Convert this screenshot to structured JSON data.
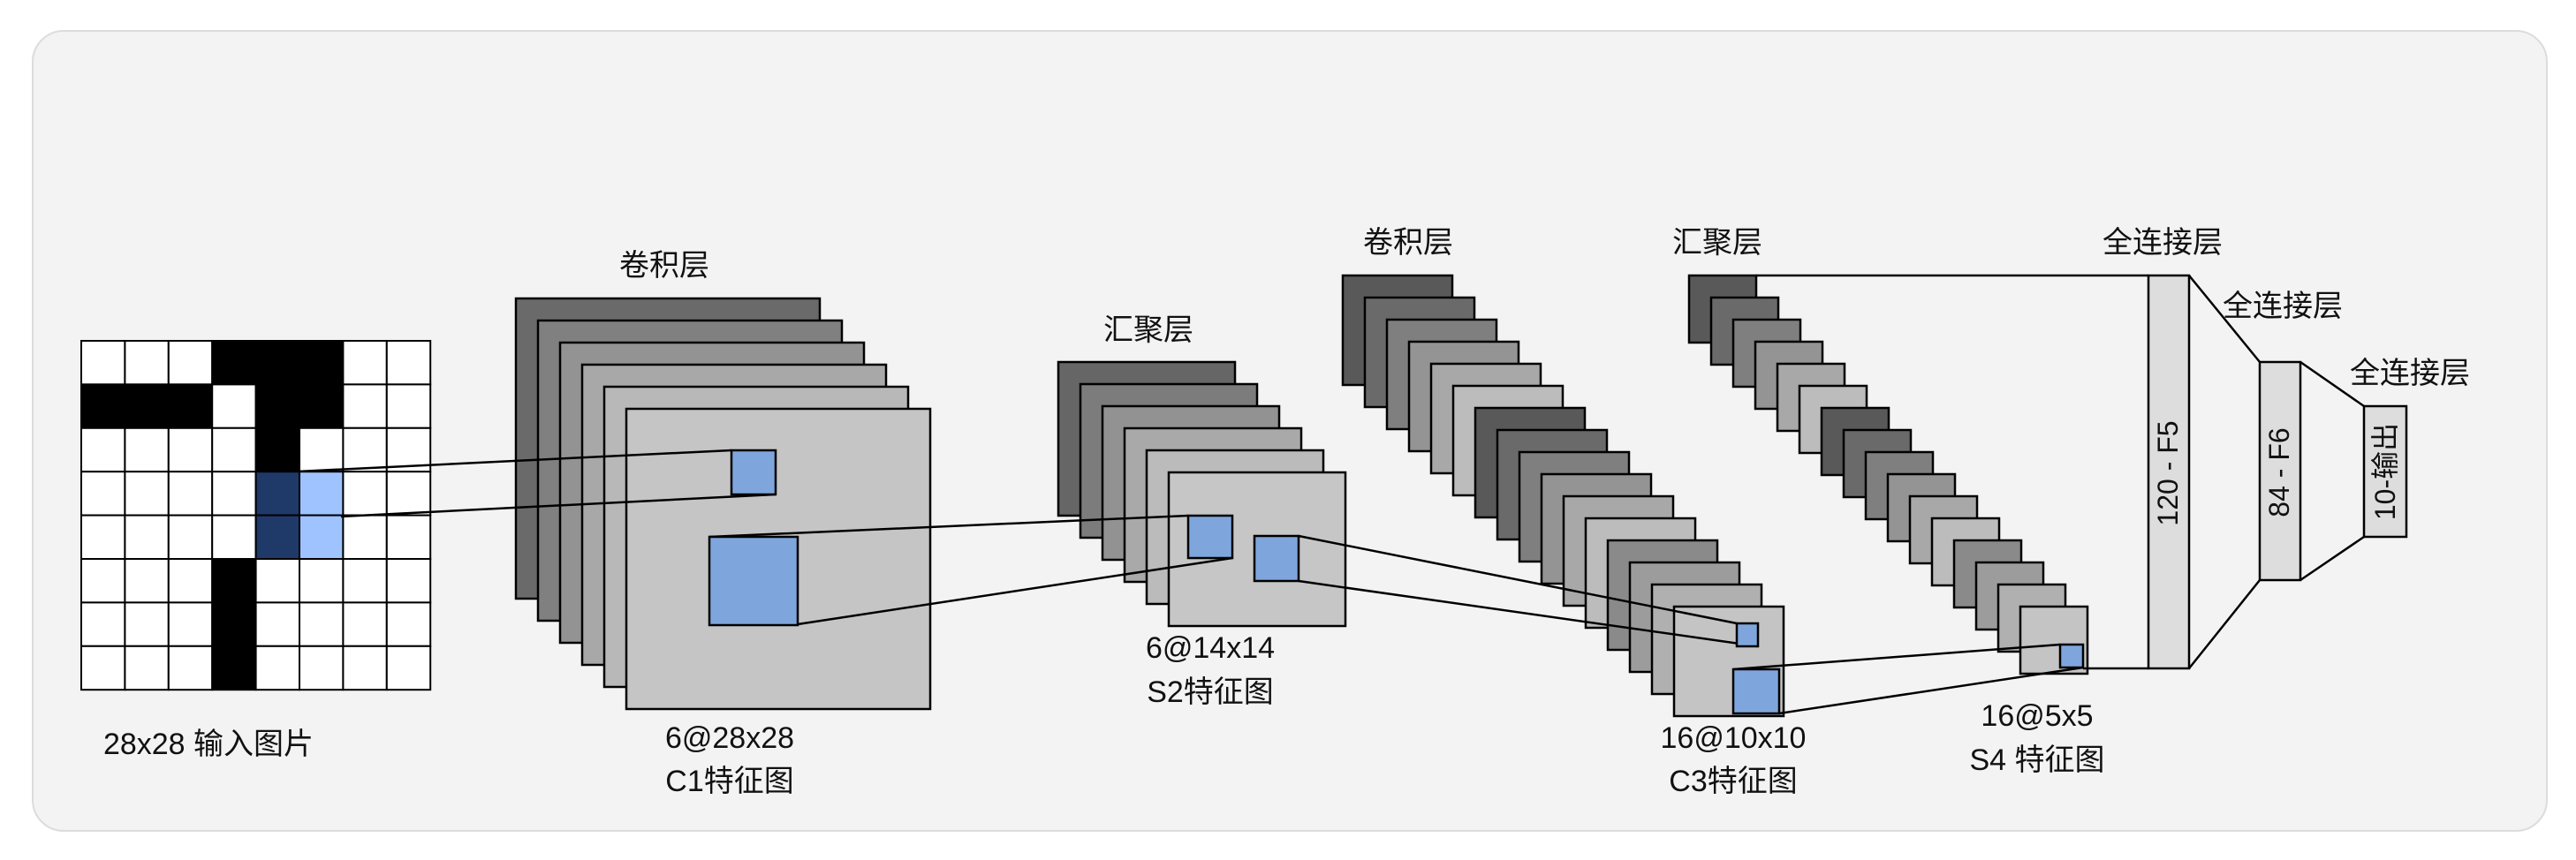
{
  "input": {
    "caption": "28x28 输入图片",
    "grid_cols": 8,
    "grid_rows": 8,
    "black_cells": [
      [
        0,
        3
      ],
      [
        0,
        4
      ],
      [
        0,
        5
      ],
      [
        1,
        0
      ],
      [
        1,
        1
      ],
      [
        1,
        2
      ],
      [
        1,
        4
      ],
      [
        1,
        5
      ],
      [
        2,
        4
      ],
      [
        3,
        4
      ],
      [
        4,
        4
      ],
      [
        5,
        3
      ],
      [
        6,
        3
      ],
      [
        7,
        3
      ]
    ],
    "kernel_dark_cells": [
      [
        3,
        4
      ],
      [
        4,
        4
      ]
    ],
    "kernel_light_cells": [
      [
        3,
        5
      ],
      [
        4,
        5
      ]
    ]
  },
  "layers": {
    "c1": {
      "title": "卷积层",
      "shape": "6@28x28",
      "name": "C1特征图"
    },
    "s2": {
      "title": "汇聚层",
      "shape": "6@14x14",
      "name": "S2特征图"
    },
    "c3": {
      "title": "卷积层",
      "shape": "16@10x10",
      "name": "C3特征图"
    },
    "s4": {
      "title": "汇聚层",
      "shape": "16@5x5",
      "name": "S4 特征图"
    },
    "f5": {
      "title": "全连接层",
      "label": "120 - F5"
    },
    "f6": {
      "title": "全连接层",
      "label": "84 - F6"
    },
    "out": {
      "title": "全连接层",
      "label": "10-输出"
    }
  },
  "colors": {
    "card_bg": "#f3f3f3",
    "kernel_blue": "#7fa6dc",
    "kernel_dark": "#1f3a68",
    "kernel_light": "#9fc3ff",
    "stack_c1": [
      "#6a6a6a",
      "#808080",
      "#939393",
      "#a8a8a8",
      "#b8b8b8",
      "#c5c5c5"
    ],
    "stack_s2": [
      "#666666",
      "#7c7c7c",
      "#929292",
      "#a9a9a9",
      "#bbbbbb",
      "#c6c6c6"
    ],
    "stack_c3": [
      "#595959",
      "#6a6a6a",
      "#7f7f7f",
      "#949494",
      "#a8a8a8",
      "#bcbcbc",
      "#595959",
      "#6a6a6a",
      "#7f7f7f",
      "#949494",
      "#a8a8a8",
      "#bcbcbc",
      "#8a8a8a",
      "#9c9c9c",
      "#b0b0b0",
      "#c4c4c4"
    ],
    "stack_s4": [
      "#595959",
      "#6a6a6a",
      "#7f7f7f",
      "#949494",
      "#a8a8a8",
      "#bcbcbc",
      "#595959",
      "#6a6a6a",
      "#7f7f7f",
      "#949494",
      "#a8a8a8",
      "#bcbcbc",
      "#8a8a8a",
      "#9c9c9c",
      "#b0b0b0",
      "#c4c4c4"
    ],
    "fc_fill": "#dddddd"
  }
}
